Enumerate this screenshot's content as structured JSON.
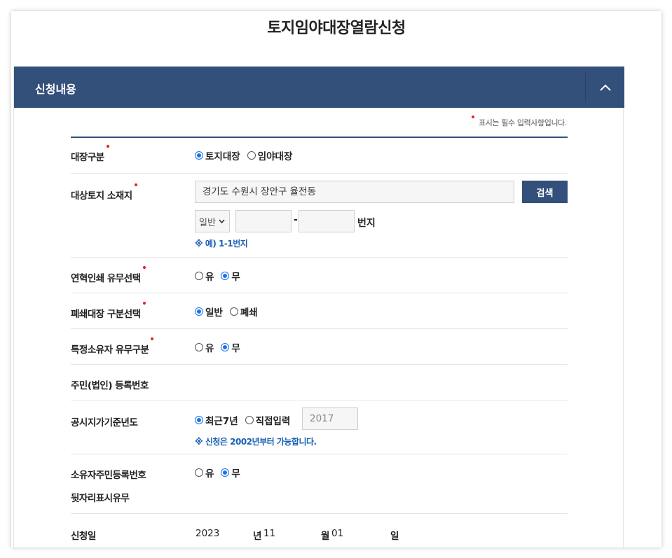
{
  "page": {
    "title": "토지임야대장열람신청"
  },
  "panel": {
    "title": "신청내용"
  },
  "required_note": "표시는 필수 입력사항입니다.",
  "rows": {
    "ledger_type": {
      "label": "대장구분",
      "options": [
        "토지대장",
        "임야대장"
      ],
      "selected": 0
    },
    "location": {
      "label": "대상토지 소재지",
      "address": "경기도 수원시 장안구 율전동",
      "search_button": "검색",
      "lot_type": "일반",
      "main_number": "",
      "sub_number": "",
      "dash": "-",
      "unit": "번지",
      "hint": "※ 예) 1-1번지"
    },
    "history_print": {
      "label": "연혁인쇄 유무선택",
      "options": [
        "유",
        "무"
      ],
      "selected": 1
    },
    "closed_ledger": {
      "label": "폐쇄대장 구분선택",
      "options": [
        "일반",
        "폐쇄"
      ],
      "selected": 0
    },
    "specific_owner": {
      "label": "특정소유자 유무구분",
      "options": [
        "유",
        "무"
      ],
      "selected": 1
    },
    "resident_number": {
      "label": "주민(법인) 등록번호"
    },
    "base_year": {
      "label": "공시지가기준년도",
      "options": [
        "최근7년",
        "직접입력"
      ],
      "selected": 0,
      "year_value": "2017",
      "hint": "※ 신청은 2002년부터 가능합니다."
    },
    "owner_id_suffix": {
      "label_line1": "소유자주민등록번호",
      "label_line2": "뒷자리표시유무",
      "options": [
        "유",
        "무"
      ],
      "selected": 1
    },
    "apply_date": {
      "label": "신청일",
      "year": "2023",
      "year_unit": "년",
      "month": "11",
      "month_unit": "월",
      "day": "01",
      "day_unit": "일"
    }
  },
  "colors": {
    "header": "#33507b",
    "accent": "#1a73e8",
    "required": "#e0202a",
    "hint": "#1a5fb4"
  }
}
